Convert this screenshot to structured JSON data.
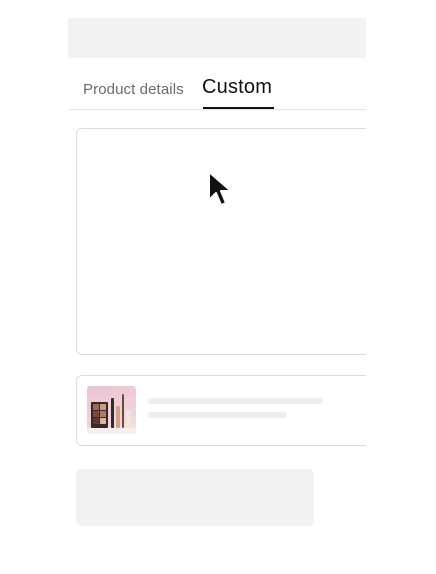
{
  "tabs": {
    "product_details": "Product details",
    "custom": "Custom"
  },
  "active_tab": "Custom",
  "colors": {
    "active_tab_text": "#111111",
    "inactive_tab_text": "#6b6b6b",
    "skeleton": "#eeeeee",
    "placeholder_block": "#f2f2f2",
    "border": "#dcdcdc"
  },
  "icons": {
    "cursor": "mouse-pointer-icon",
    "thumbnail": "makeup-products-image"
  }
}
